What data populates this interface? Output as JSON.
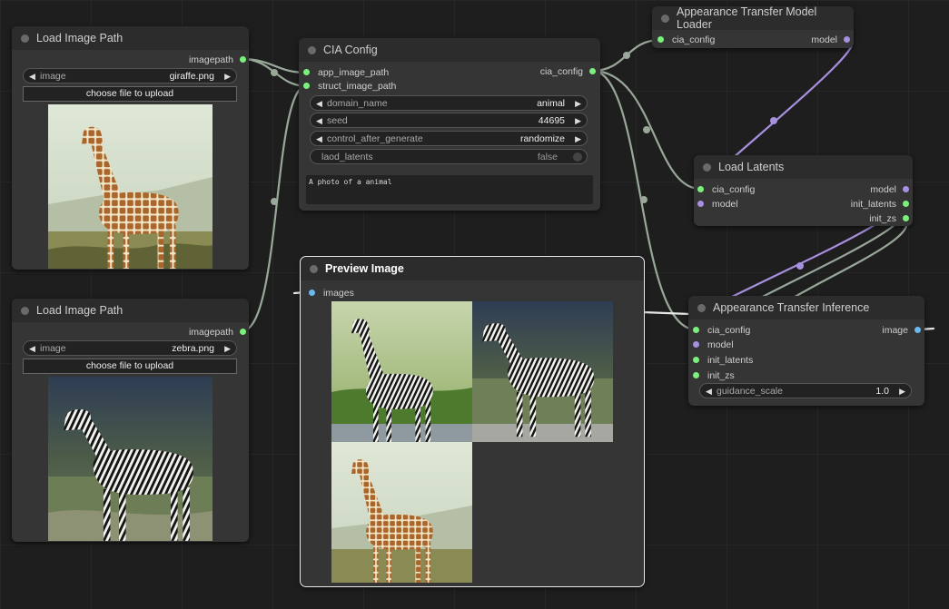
{
  "nodes": {
    "load_image_1": {
      "title": "Load Image Path",
      "output": "imagepath",
      "image_label": "image",
      "image_value": "giraffe.png",
      "upload_label": "choose file to upload",
      "preview_icon": "giraffe-photo"
    },
    "load_image_2": {
      "title": "Load Image Path",
      "output": "imagepath",
      "image_label": "image",
      "image_value": "zebra.png",
      "upload_label": "choose file to upload",
      "preview_icon": "zebra-photo"
    },
    "cia_config": {
      "title": "CIA Config",
      "inputs": [
        "app_image_path",
        "struct_image_path"
      ],
      "output": "cia_config",
      "widgets": {
        "domain_name": {
          "label": "domain_name",
          "value": "animal"
        },
        "seed": {
          "label": "seed",
          "value": "44695"
        },
        "control_after_generate": {
          "label": "control_after_generate",
          "value": "randomize"
        },
        "laod_latents": {
          "label": "laod_latents",
          "value": "false"
        }
      },
      "prompt": "A photo of a animal"
    },
    "model_loader": {
      "title": "Appearance Transfer Model Loader",
      "input": "cia_config",
      "output": "model"
    },
    "load_latents": {
      "title": "Load Latents",
      "inputs": [
        "cia_config",
        "model"
      ],
      "outputs": [
        "model",
        "init_latents",
        "init_zs"
      ]
    },
    "preview": {
      "title": "Preview Image",
      "input": "images",
      "images": [
        "zebra-striped-giraffe",
        "zebra",
        "giraffe"
      ]
    },
    "inference": {
      "title": "Appearance Transfer Inference",
      "inputs": [
        "cia_config",
        "model",
        "init_latents",
        "init_zs"
      ],
      "output": "image",
      "guidance": {
        "label": "guidance_scale",
        "value": "1.0"
      }
    }
  },
  "colors": {
    "config_link": "#9aa89a",
    "model_link": "#a890e0",
    "image_link": "#e8e8e8",
    "slot_green": "#7cf07c",
    "slot_purple": "#a890e0",
    "slot_blue": "#6ab8f0"
  }
}
